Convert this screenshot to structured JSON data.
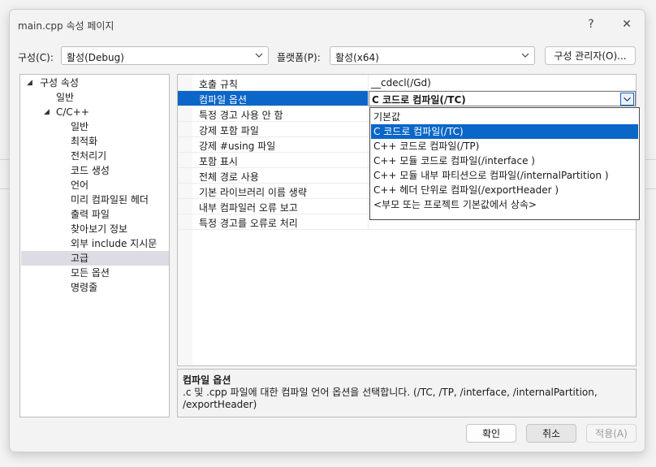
{
  "window": {
    "title": "main.cpp 속성 페이지",
    "help": "?",
    "close": "✕"
  },
  "toolbar": {
    "config_label": "구성(C):",
    "config_value": "활성(Debug)",
    "platform_label": "플랫폼(P):",
    "platform_value": "활성(x64)",
    "config_manager": "구성 관리자(O)..."
  },
  "tree": {
    "root": "구성 속성",
    "general": "일반",
    "cpp": "C/C++",
    "children": [
      "일반",
      "최적화",
      "전처리기",
      "코드 생성",
      "언어",
      "미리 컴파일된 헤더",
      "출력 파일",
      "찾아보기 정보",
      "외부 include 지시문",
      "고급",
      "모든 옵션",
      "명령줄"
    ],
    "selected": "고급"
  },
  "grid": {
    "rows": [
      {
        "name": "호출 규칙",
        "value": "__cdecl(/Gd)"
      },
      {
        "name": "컴파일 옵션",
        "value": "C 코드로 컴파일(/TC)"
      },
      {
        "name": "특정 경고 사용 안 함",
        "value": ""
      },
      {
        "name": "강제 포함 파일",
        "value": ""
      },
      {
        "name": "강제 #using 파일",
        "value": ""
      },
      {
        "name": "포함 표시",
        "value": ""
      },
      {
        "name": "전체 경로 사용",
        "value": ""
      },
      {
        "name": "기본 라이브러리 이름 생략",
        "value": ""
      },
      {
        "name": "내부 컴파일러 오류 보고",
        "value": ""
      },
      {
        "name": "특정 경고를 오류로 처리",
        "value": ""
      }
    ],
    "selected_index": 1
  },
  "dropdown": {
    "options": [
      "기본값",
      "C 코드로 컴파일(/TC)",
      "C++ 코드로 컴파일(/TP)",
      "C++ 모듈 코드로 컴파일(/interface )",
      "C++ 모듈 내부 파티션으로 컴파일(/internalPartition )",
      "C++ 헤더 단위로 컴파일(/exportHeader )",
      "<부모 또는 프로젝트 기본값에서 상속>"
    ],
    "selected_index": 1
  },
  "description": {
    "title": "컴파일 옵션",
    "text": ".c 및 .cpp 파일에 대한 컴파일 언어 옵션을 선택합니다.     (/TC, /TP, /interface, /internalPartition, /exportHeader)"
  },
  "buttons": {
    "ok": "확인",
    "cancel": "취소",
    "apply": "적용(A)"
  },
  "colors": {
    "selection": "#0a66c8",
    "tree_selection": "#dcdce4"
  }
}
